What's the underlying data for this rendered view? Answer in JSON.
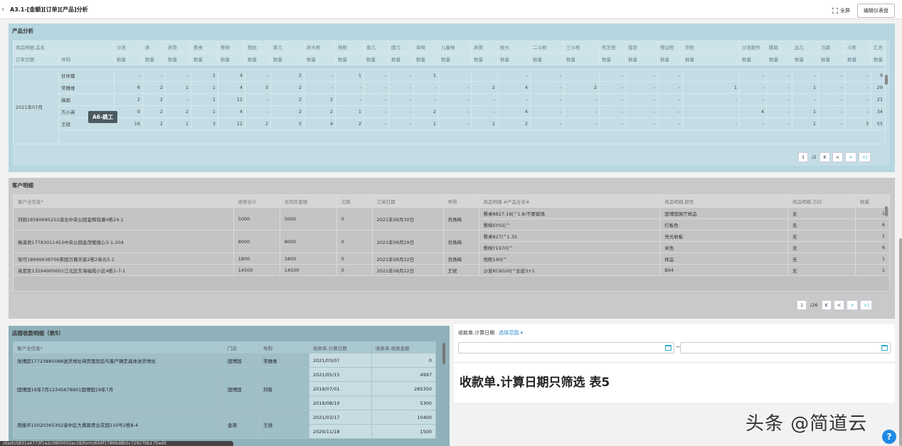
{
  "header": {
    "back_icon": "chevron-left-icon",
    "title": "A3.1-[金额][订单][产品]分析",
    "fullscreen_label": "全屏",
    "edit_label": "编辑仪表盘"
  },
  "product_panel": {
    "title": "产品分析",
    "header_row1_label": "商品明细.品名",
    "header_row2_col1": "订单日期",
    "header_row2_col2": "导购",
    "categories": [
      "沙发",
      "床",
      "床垫",
      "餐桌",
      "餐椅",
      "抱枕",
      "茶几",
      "床头柜",
      "地柜",
      "角几",
      "圆几",
      "单椅",
      "儿童椅",
      "床凳",
      "枕头",
      "二斗柜",
      "三斗柜",
      "布艺柜",
      "毯垫",
      "餐边柜",
      "货柜",
      "沙发配件",
      "脚踏",
      "边几",
      "马踏",
      "斗柜",
      "汇总"
    ],
    "measure_label": "数量",
    "date_group": "2021年07月",
    "rows": [
      {
        "name": "甘休健",
        "values": [
          "-",
          "-",
          "-",
          "1",
          "4",
          "-",
          "2",
          "-",
          "1",
          "-",
          "-",
          "1",
          "",
          "",
          "-",
          "-",
          "",
          "-",
          "-",
          "-",
          "",
          "-",
          "-",
          "-",
          "-",
          "-",
          "9"
        ]
      },
      {
        "name": "常雅维",
        "values": [
          "6",
          "2",
          "1",
          "1",
          "4",
          "3",
          "2",
          "-",
          "-",
          "-",
          "-",
          "-",
          "-",
          "2",
          "4",
          "-",
          "2",
          "-",
          "-",
          "-",
          "1",
          "-",
          "-",
          "1",
          "-",
          "-",
          "29"
        ]
      },
      {
        "name": "锡画",
        "values": [
          "2",
          "2",
          "-",
          "1",
          "12",
          "-",
          "2",
          "2",
          "-",
          "-",
          "-",
          "-",
          "-",
          "-",
          "-",
          "-",
          "-",
          "-",
          "-",
          "-",
          "-",
          "-",
          "-",
          "-",
          "-",
          "-",
          "21"
        ]
      },
      {
        "name": "方小英",
        "values": [
          "9",
          "2",
          "2",
          "1",
          "4",
          "-",
          "2",
          "2",
          "1",
          "-",
          "-",
          "2",
          "-",
          "-",
          "4",
          "-",
          "-",
          "-",
          "-",
          "-",
          "-",
          "4",
          "-",
          "1",
          "-",
          "-",
          "34"
        ]
      },
      {
        "name": "王锐",
        "values": [
          "16",
          "2",
          "1",
          "3",
          "12",
          "2",
          "5",
          "4",
          "2",
          "-",
          "-",
          "1",
          "-",
          "1",
          "2",
          "-",
          "-",
          "-",
          "-",
          "-",
          "-",
          "-",
          "-",
          "1",
          "-",
          "3",
          "55"
        ]
      }
    ],
    "pager": {
      "current": "1",
      "total": "/2",
      "first": "K",
      "prev": "<",
      "next": ">",
      "last": ">|"
    },
    "tooltip": "A6-跳工"
  },
  "customer_panel": {
    "title": "客户明细",
    "columns": [
      "客户全信息*",
      "收款合计",
      "合同总金额",
      "欠款",
      "订单日期",
      "导购",
      "商品明细.#产品全名#",
      "商品明细.颜色",
      "商品明细.方向",
      "数量"
    ],
    "rows": [
      {
        "customer": "刘刚18580685252渝北中央公园金辉铭著4栋24-1",
        "received": "5000",
        "contract": "5000",
        "owed": "0",
        "date": "2021年08月30日",
        "guide": "肖扬梅",
        "items": [
          {
            "product": "餐桌8827-18|^1.8/不要玻璃",
            "color": "固博固展厅样品",
            "dir": "无",
            "qty": "1"
          },
          {
            "product": "餐椅SY02|^",
            "color": "打板色",
            "dir": "无",
            "qty": "6"
          }
        ]
      },
      {
        "customer": "杨道君17783011453中央公园金茂璧捷心3-1-204",
        "received": "8000",
        "contract": "8000",
        "owed": "0",
        "date": "2021年08月29日",
        "guide": "肖扬梅",
        "items": [
          {
            "product": "餐桌827|^1.35",
            "color": "亮光岩板",
            "dir": "无",
            "qty": "1"
          },
          {
            "product": "餐椅Y1970|^",
            "color": "米色",
            "dir": "无",
            "qty": "6"
          }
        ]
      },
      {
        "customer": "张可18696638706茶园万幕天宸2栋2单元5-1",
        "received": "1800",
        "contract": "1800",
        "owed": "0",
        "date": "2021年08月22日",
        "guide": "肖扬梅",
        "items": [
          {
            "product": "地柜190|^",
            "color": "样品",
            "dir": "无",
            "qty": "1"
          }
        ]
      },
      {
        "customer": "高爱民13594900001江北区东海福苑小区4栋1-7-1",
        "received": "14500",
        "contract": "14500",
        "owed": "0",
        "date": "2021年08月22日",
        "guide": "王锐",
        "items": [
          {
            "product": "沙发KC6020|^全皮3+1",
            "color": "B04",
            "dir": "无",
            "qty": "1"
          }
        ]
      }
    ],
    "pager": {
      "current": "1",
      "total": "/26",
      "first": "K",
      "prev": "<",
      "next": ">",
      "last": ">|"
    }
  },
  "store_panel": {
    "title": "店面收款明细（表5）",
    "columns": [
      "客户全信息*",
      "门店",
      "导购",
      "收款单.计算日期",
      "收款单.收款金额"
    ],
    "rows": [
      {
        "customer": "张博超17723885088送货地址待页面到后与客户确定具体送货地址",
        "store": "固博固",
        "guide": "常雅维",
        "entries": [
          {
            "date": "2021/03/07",
            "amount": "0"
          }
        ]
      },
      {
        "customer": "固博固19年7月12345678901固博固19年7月",
        "store": "固博固",
        "guide": "刘筱",
        "entries": [
          {
            "date": "2021/05/15",
            "amount": "4997"
          },
          {
            "date": "2019/07/01",
            "amount": "285350"
          },
          {
            "date": "2019/08/10",
            "amount": "5300"
          }
        ]
      },
      {
        "customer": "周振声15020365302渝中区大黄路青业花园110号2栋8-4",
        "store": "金源",
        "guide": "王锐",
        "entries": [
          {
            "date": "2021/03/17",
            "amount": "10400"
          },
          {
            "date": "2020/11/18",
            "amount": "1500"
          }
        ]
      }
    ]
  },
  "filter_widget": {
    "label": "收款单.计算日期",
    "link": "选择范围",
    "separator": "~",
    "start_value": "",
    "end_value": ""
  },
  "text_widget": {
    "text": "收款单.计算日期只筛选 表5"
  },
  "watermark": "头条 @简道云",
  "help": "?",
  "status_url": "/dash/5831a4773f1e2c0800002ac18/form/604f17896d8b5c72927bb17f/edit"
}
